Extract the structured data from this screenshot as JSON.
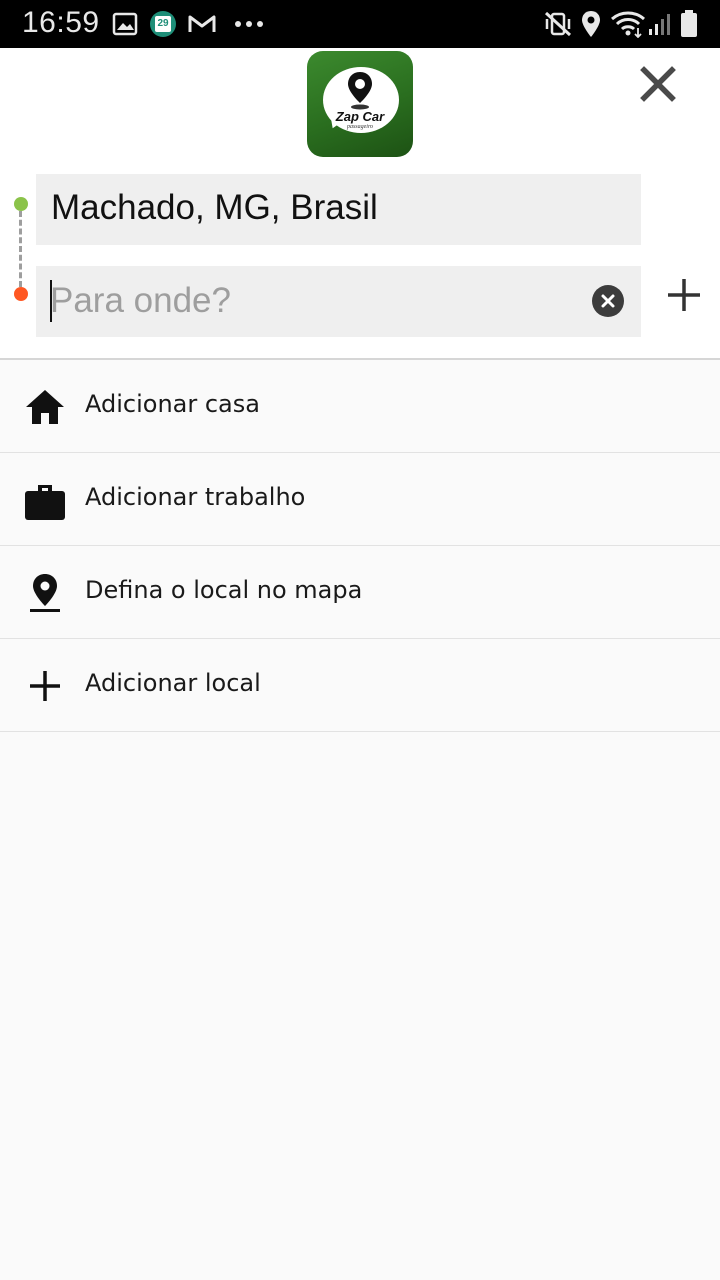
{
  "status_bar": {
    "time": "16:59",
    "calendar_day": "29",
    "left_icons": [
      "image-icon",
      "calendar-icon",
      "gmail-icon",
      "more-dots-icon"
    ],
    "right_icons": [
      "mute-vibrate-icon",
      "location-icon",
      "wifi-icon",
      "signal-icon",
      "battery-icon"
    ]
  },
  "logo": {
    "brand": "Zap Car",
    "tagline": "passageiro"
  },
  "route": {
    "origin": "Machado, MG, Brasil",
    "destination_value": "",
    "destination_placeholder": "Para onde?",
    "colors": {
      "start": "#8bc34a",
      "end": "#ff5722"
    }
  },
  "list": {
    "items": [
      {
        "icon": "home-icon",
        "label": "Adicionar casa"
      },
      {
        "icon": "briefcase-icon",
        "label": "Adicionar trabalho"
      },
      {
        "icon": "map-pin-icon",
        "label": "Defina o local no mapa"
      },
      {
        "icon": "plus-icon",
        "label": "Adicionar local"
      }
    ]
  }
}
